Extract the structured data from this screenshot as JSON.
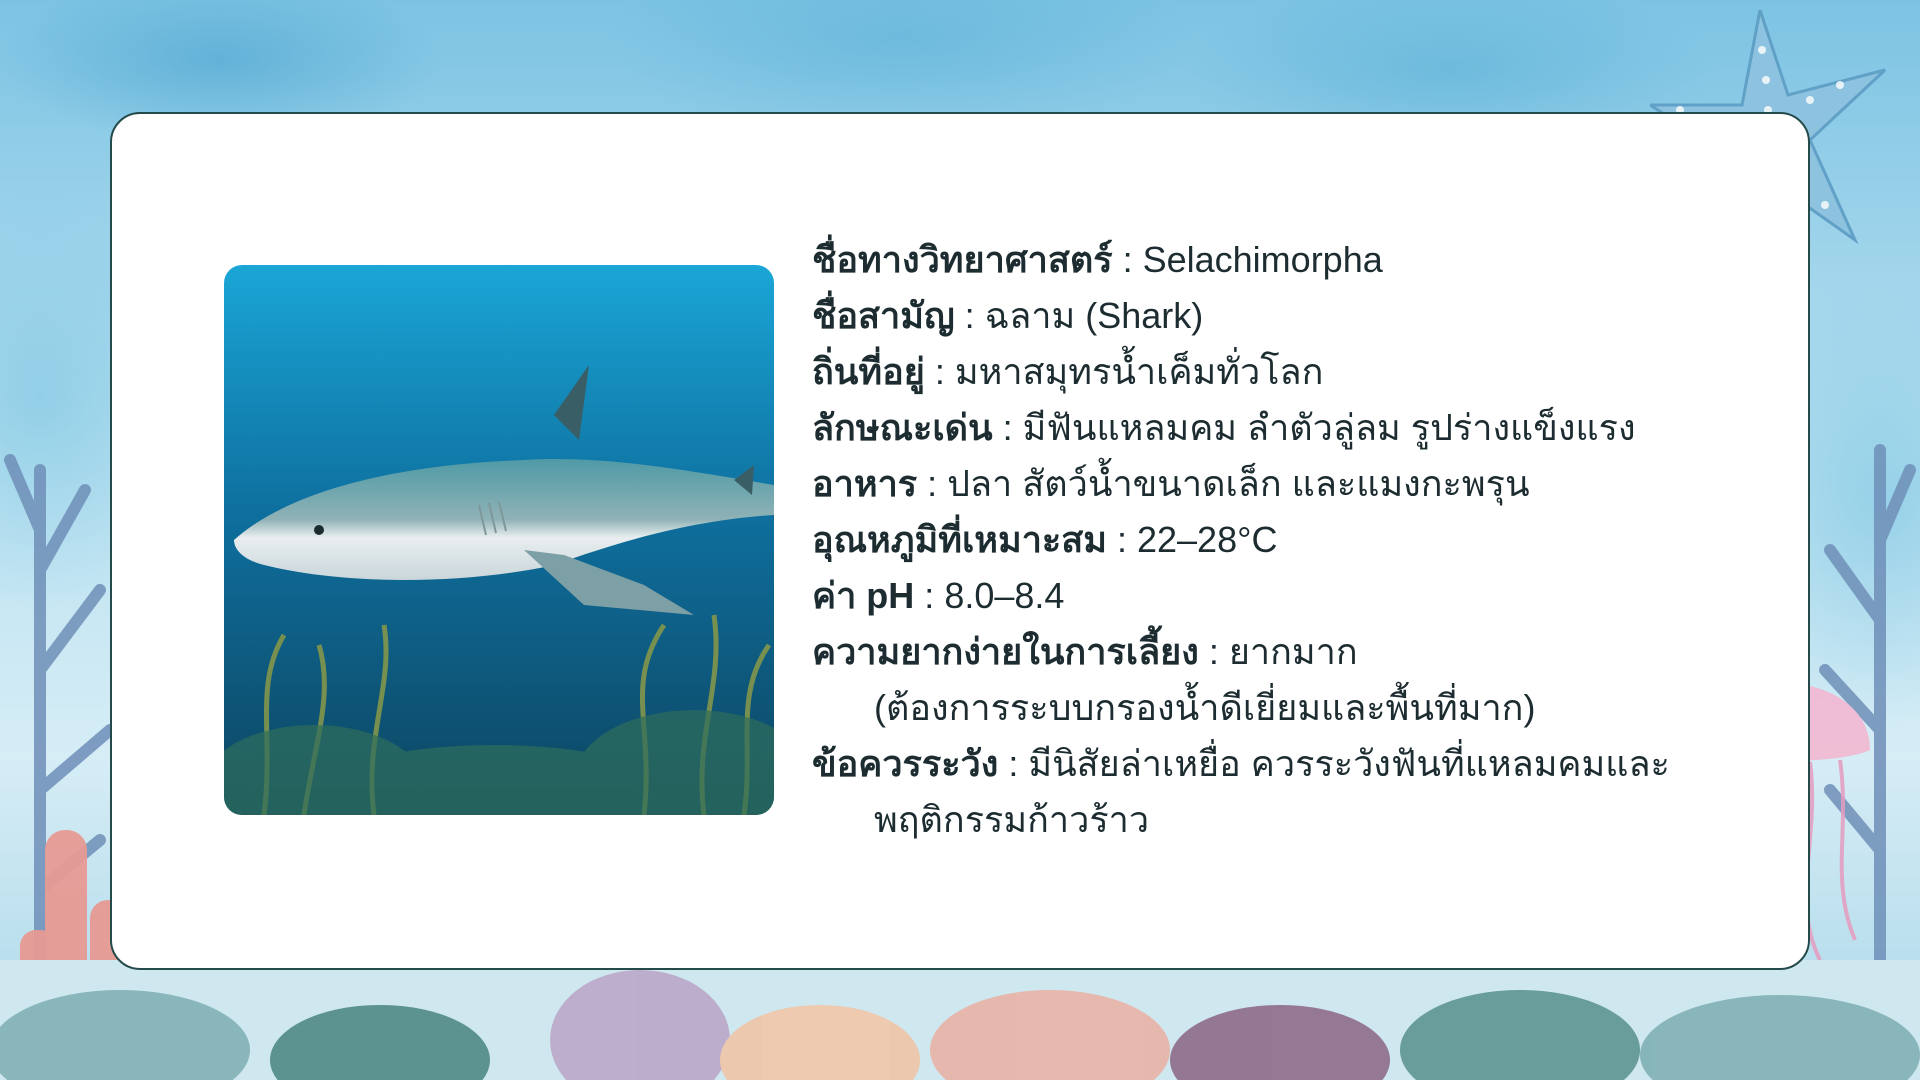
{
  "species": {
    "scientific_name": {
      "label": "ชื่อทางวิทยาศาสตร์",
      "value": "Selachimorpha"
    },
    "common_name": {
      "label": "ชื่อสามัญ",
      "value": "ฉลาม (Shark)"
    },
    "habitat": {
      "label": "ถิ่นที่อยู่",
      "value": "มหาสมุทรน้ำเค็มทั่วโลก"
    },
    "features": {
      "label": "ลักษณะเด่น",
      "value": "มีฟันแหลมคม ลำตัวลู่ลม รูปร่างแข็งแรง"
    },
    "food": {
      "label": "อาหาร",
      "value": "ปลา สัตว์น้ำขนาดเล็ก และแมงกะพรุน"
    },
    "temperature": {
      "label": "อุณหภูมิที่เหมาะสม",
      "value": "22–28°C"
    },
    "ph": {
      "label": "ค่า pH",
      "value": "8.0–8.4"
    },
    "difficulty": {
      "label": "ความยากง่ายในการเลี้ยง",
      "value": "ยากมาก",
      "note": "(ต้องการระบบกรองน้ำดีเยี่ยมและพื้นที่มาก)"
    },
    "caution": {
      "label": "ข้อควรระวัง",
      "value": "มีนิสัยล่าเหยื่อ ควรระวังฟันที่แหลมคมและ",
      "value_cont": "พฤติกรรมก้าวร้าว"
    }
  },
  "separator": " : ",
  "icons": {
    "photo": "shark-photo",
    "starfish": "starfish-icon",
    "jellyfish": "jellyfish-icon"
  },
  "colors": {
    "card_border": "#254a4a",
    "text": "#1c2c30",
    "water_top": "#1aa6d6",
    "water_bottom": "#0d4560"
  }
}
